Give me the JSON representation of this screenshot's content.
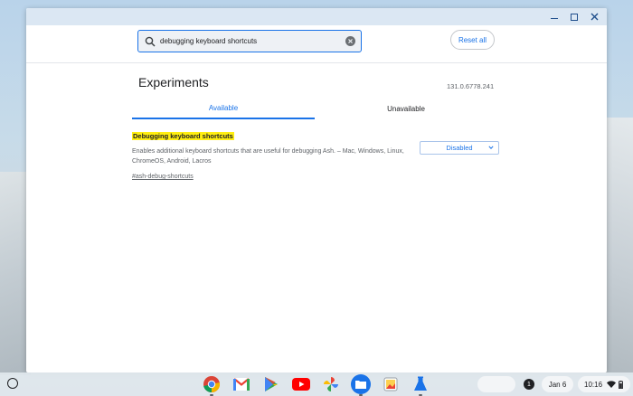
{
  "window": {
    "controls": [
      "minimize-icon",
      "maximize-icon",
      "close-icon"
    ]
  },
  "toolbar": {
    "search_value": "debugging keyboard shortcuts",
    "reset_label": "Reset all"
  },
  "page": {
    "title": "Experiments",
    "version": "131.0.6778.241"
  },
  "tabs": [
    {
      "label": "Available",
      "active": true
    },
    {
      "label": "Unavailable",
      "active": false
    }
  ],
  "experiment": {
    "title": "Debugging keyboard shortcuts",
    "description": "Enables additional keyboard shortcuts that are useful for debugging Ash. – Mac, Windows, Linux, ChromeOS, Android, Lacros",
    "link": "#ash-debug-shortcuts",
    "selected": "Disabled"
  },
  "shelf": {
    "apps": [
      "chrome-icon",
      "gmail-icon",
      "play-store-icon",
      "youtube-icon",
      "photos-icon",
      "files-icon",
      "gallery-icon",
      "flask-icon"
    ],
    "notification_count": "1",
    "date": "Jan 6",
    "time": "10:16"
  },
  "colors": {
    "accent": "#1a73e8",
    "highlight": "#ffee11",
    "titlebar": "#dbe7f3"
  }
}
